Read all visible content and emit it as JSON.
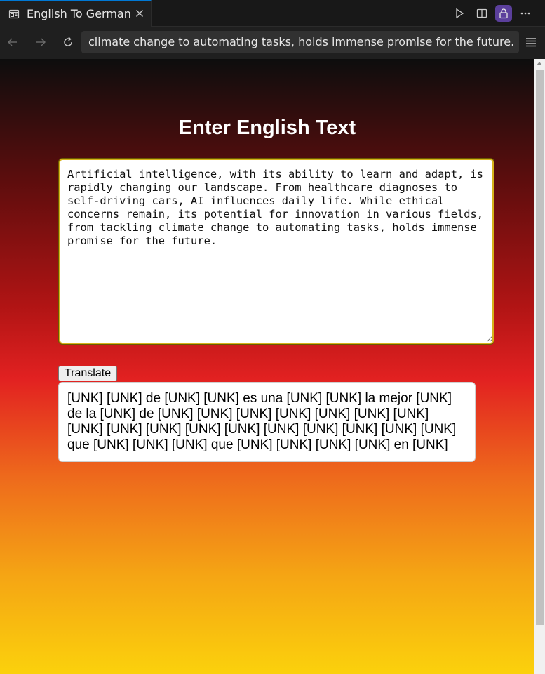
{
  "tab": {
    "title": "English To German"
  },
  "address_bar": {
    "url": "climate change to automating tasks, holds immense promise for the future."
  },
  "page": {
    "heading": "Enter English Text",
    "input_text": "Artificial intelligence, with its ability to learn and adapt, is rapidly changing our landscape. From healthcare diagnoses to self-driving cars, AI influences daily life. While ethical concerns remain, its potential for innovation in various fields, from tackling climate change to automating tasks, holds immense promise for the future.",
    "translate_label": "Translate",
    "output_text": "[UNK] [UNK] de [UNK] [UNK] es una [UNK] [UNK] la mejor [UNK] de la [UNK] de [UNK] [UNK] [UNK] [UNK] [UNK] [UNK] [UNK] [UNK] [UNK] [UNK] [UNK] [UNK] [UNK] [UNK] [UNK] [UNK] [UNK] que [UNK] [UNK] [UNK] que [UNK] [UNK] [UNK] [UNK] en [UNK]"
  },
  "colors": {
    "gradient_top": "#0d0d0d",
    "gradient_mid": "#e22121",
    "gradient_bottom": "#fbd10c",
    "focus_border": "#d6b21a",
    "active_toolbar_button": "#5b3f9c"
  }
}
